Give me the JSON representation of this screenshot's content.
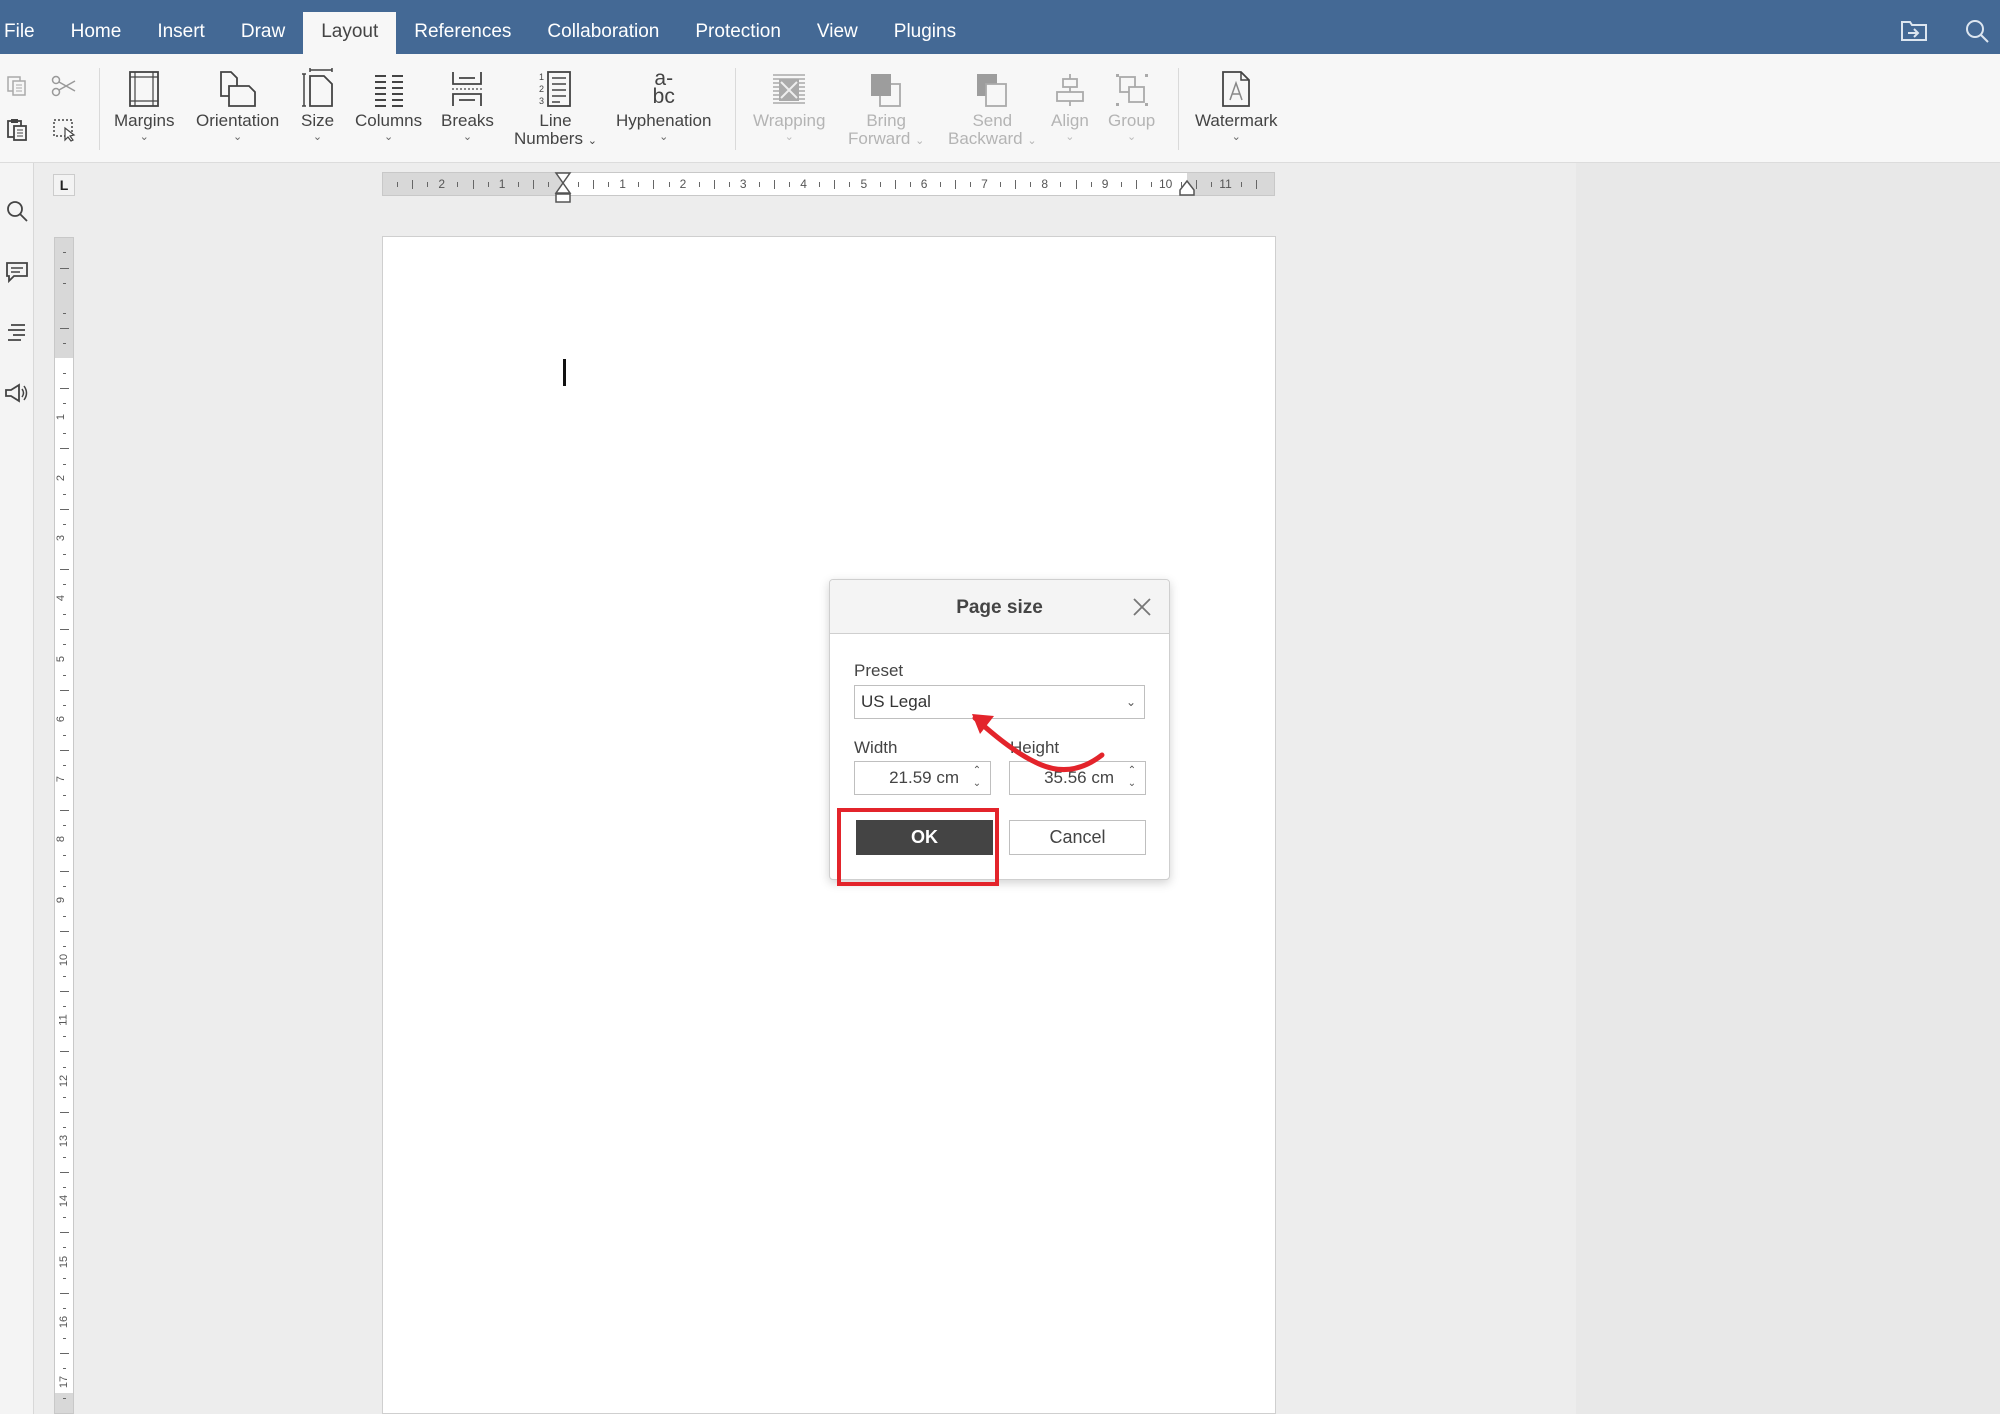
{
  "menu": {
    "tabs": [
      {
        "label": "File"
      },
      {
        "label": "Home"
      },
      {
        "label": "Insert"
      },
      {
        "label": "Draw"
      },
      {
        "label": "Layout",
        "active": true
      },
      {
        "label": "References"
      },
      {
        "label": "Collaboration"
      },
      {
        "label": "Protection"
      },
      {
        "label": "View"
      },
      {
        "label": "Plugins"
      }
    ],
    "right_icons": [
      "open-file-location-icon",
      "search-icon"
    ]
  },
  "ribbon": {
    "clipboard_icons": [
      "copy-icon",
      "cut-icon",
      "paste-icon",
      "select-all-icon"
    ],
    "buttons": [
      {
        "label": "Margins",
        "icon": "margins-icon"
      },
      {
        "label": "Orientation",
        "icon": "orientation-icon"
      },
      {
        "label": "Size",
        "icon": "size-icon"
      },
      {
        "label": "Columns",
        "icon": "columns-icon"
      },
      {
        "label": "Breaks",
        "icon": "breaks-icon"
      },
      {
        "label_line1": "Line",
        "label_line2": "Numbers",
        "icon": "line-numbers-icon"
      },
      {
        "label": "Hyphenation",
        "icon": "hyphenation-icon",
        "icon_text_top": "a-",
        "icon_text_bottom": "bc"
      },
      {
        "label": "Wrapping",
        "icon": "wrapping-icon",
        "disabled": true
      },
      {
        "label_line1": "Bring",
        "label_line2": "Forward",
        "icon": "bring-forward-icon",
        "disabled": true
      },
      {
        "label_line1": "Send",
        "label_line2": "Backward",
        "icon": "send-backward-icon",
        "disabled": true
      },
      {
        "label": "Align",
        "icon": "align-icon",
        "disabled": true
      },
      {
        "label": "Group",
        "icon": "group-icon",
        "disabled": true
      },
      {
        "label": "Watermark",
        "icon": "watermark-icon"
      }
    ]
  },
  "sidebar": {
    "icons": [
      "search-icon",
      "comments-icon",
      "navigation-icon",
      "feedback-icon"
    ]
  },
  "rulers": {
    "tab_selector": "L",
    "horizontal_labels_left": [
      "2",
      "1"
    ],
    "horizontal_labels": [
      "1",
      "2",
      "3",
      "4",
      "5",
      "6",
      "7",
      "8",
      "9",
      "10",
      "11"
    ],
    "vertical_labels": [
      "1",
      "2",
      "3",
      "4",
      "5",
      "6",
      "7",
      "8",
      "9",
      "10",
      "11",
      "12",
      "13",
      "14",
      "15",
      "16",
      "17"
    ]
  },
  "dialog": {
    "title": "Page size",
    "preset_label": "Preset",
    "preset_value": "US Legal",
    "width_label": "Width",
    "width_value": "21.59 cm",
    "height_label": "Height",
    "height_value": "35.56 cm",
    "ok_label": "OK",
    "cancel_label": "Cancel"
  },
  "annotations": {
    "highlight_color": "#e3242b",
    "arrow_color": "#e3242b"
  }
}
